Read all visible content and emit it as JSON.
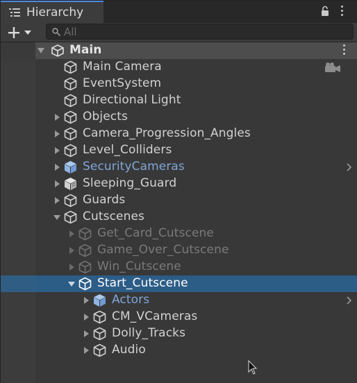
{
  "window": {
    "tab_title": "Hierarchy",
    "tab_icon": "hierarchy-list-icon",
    "lock_icon": "lock-icon",
    "menu_icon": "kebab-menu-icon"
  },
  "toolbar": {
    "add_icon": "plus-dropdown-icon",
    "search_placeholder": "All",
    "search_icon": "search-icon"
  },
  "scene": {
    "name": "Main",
    "icon": "unity-logo-icon",
    "expanded": true
  },
  "colors": {
    "accent": "#4b8ae0",
    "selection": "#2c5d87",
    "prefab_text": "#7fa6d8",
    "disabled_text": "#7a7a7a",
    "normal_text": "#d2d2d2"
  },
  "items": [
    {
      "label": "Main Camera",
      "depth": 0,
      "arrow": "none",
      "icon": "gameobject-cube-icon",
      "state": "normal",
      "gizmo": "camera-gizmo-icon"
    },
    {
      "label": "EventSystem",
      "depth": 0,
      "arrow": "none",
      "icon": "gameobject-cube-icon",
      "state": "normal"
    },
    {
      "label": "Directional Light",
      "depth": 0,
      "arrow": "none",
      "icon": "gameobject-cube-icon",
      "state": "normal"
    },
    {
      "label": "Objects",
      "depth": 0,
      "arrow": "collapsed",
      "icon": "gameobject-cube-icon",
      "state": "normal"
    },
    {
      "label": "Camera_Progression_Angles",
      "depth": 0,
      "arrow": "collapsed",
      "icon": "gameobject-cube-icon",
      "state": "normal"
    },
    {
      "label": "Level_Colliders",
      "depth": 0,
      "arrow": "collapsed",
      "icon": "gameobject-cube-icon",
      "state": "normal"
    },
    {
      "label": "SecurityCameras",
      "depth": 0,
      "arrow": "collapsed",
      "icon": "prefab-cube-icon",
      "state": "prefab",
      "chevron": true
    },
    {
      "label": "Sleeping_Guard",
      "depth": 0,
      "arrow": "collapsed",
      "icon": "prefab-model-cube-icon",
      "state": "normal"
    },
    {
      "label": "Guards",
      "depth": 0,
      "arrow": "collapsed",
      "icon": "gameobject-cube-icon",
      "state": "normal"
    },
    {
      "label": "Cutscenes",
      "depth": 0,
      "arrow": "expanded",
      "icon": "gameobject-cube-icon",
      "state": "normal"
    },
    {
      "label": "Get_Card_Cutscene",
      "depth": 1,
      "arrow": "collapsed",
      "icon": "gameobject-cube-icon",
      "state": "disabled"
    },
    {
      "label": "Game_Over_Cutscene",
      "depth": 1,
      "arrow": "collapsed",
      "icon": "gameobject-cube-icon",
      "state": "disabled"
    },
    {
      "label": "Win_Cutscene",
      "depth": 1,
      "arrow": "collapsed",
      "icon": "gameobject-cube-icon",
      "state": "disabled"
    },
    {
      "label": "Start_Cutscene",
      "depth": 1,
      "arrow": "expanded",
      "icon": "gameobject-cube-icon",
      "state": "selected"
    },
    {
      "label": "Actors",
      "depth": 2,
      "arrow": "collapsed",
      "icon": "prefab-cube-icon",
      "state": "prefab",
      "chevron": true
    },
    {
      "label": "CM_VCameras",
      "depth": 2,
      "arrow": "collapsed",
      "icon": "gameobject-cube-icon",
      "state": "normal"
    },
    {
      "label": "Dolly_Tracks",
      "depth": 2,
      "arrow": "collapsed",
      "icon": "gameobject-cube-icon",
      "state": "normal"
    },
    {
      "label": "Audio",
      "depth": 2,
      "arrow": "collapsed",
      "icon": "gameobject-cube-icon",
      "state": "normal"
    }
  ],
  "cursor_icon": "mouse-cursor-icon"
}
